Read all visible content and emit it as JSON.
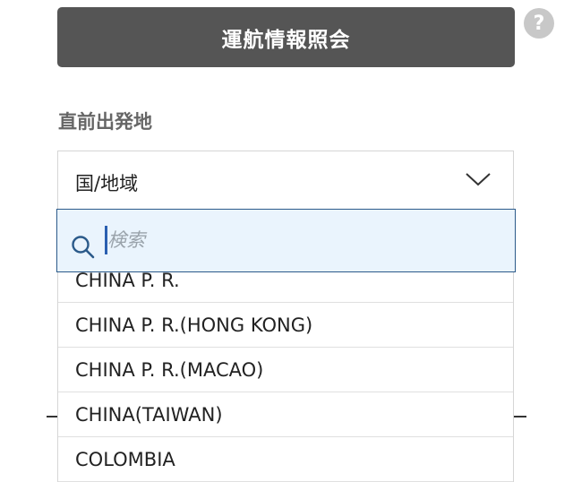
{
  "header": {
    "title": "運航情報照会"
  },
  "help": {
    "symbol": "?"
  },
  "origin": {
    "label": "直前出発地",
    "selected": "国/地域"
  },
  "search": {
    "placeholder": "検索",
    "value": ""
  },
  "options": [
    "CHINA P. R.",
    "CHINA P. R.(HONG KONG)",
    "CHINA P. R.(MACAO)",
    "CHINA(TAIWAN)",
    "COLOMBIA"
  ],
  "colors": {
    "header_bg": "#555555",
    "search_bg": "#eaf4fd",
    "search_border": "#2b5a8a"
  }
}
